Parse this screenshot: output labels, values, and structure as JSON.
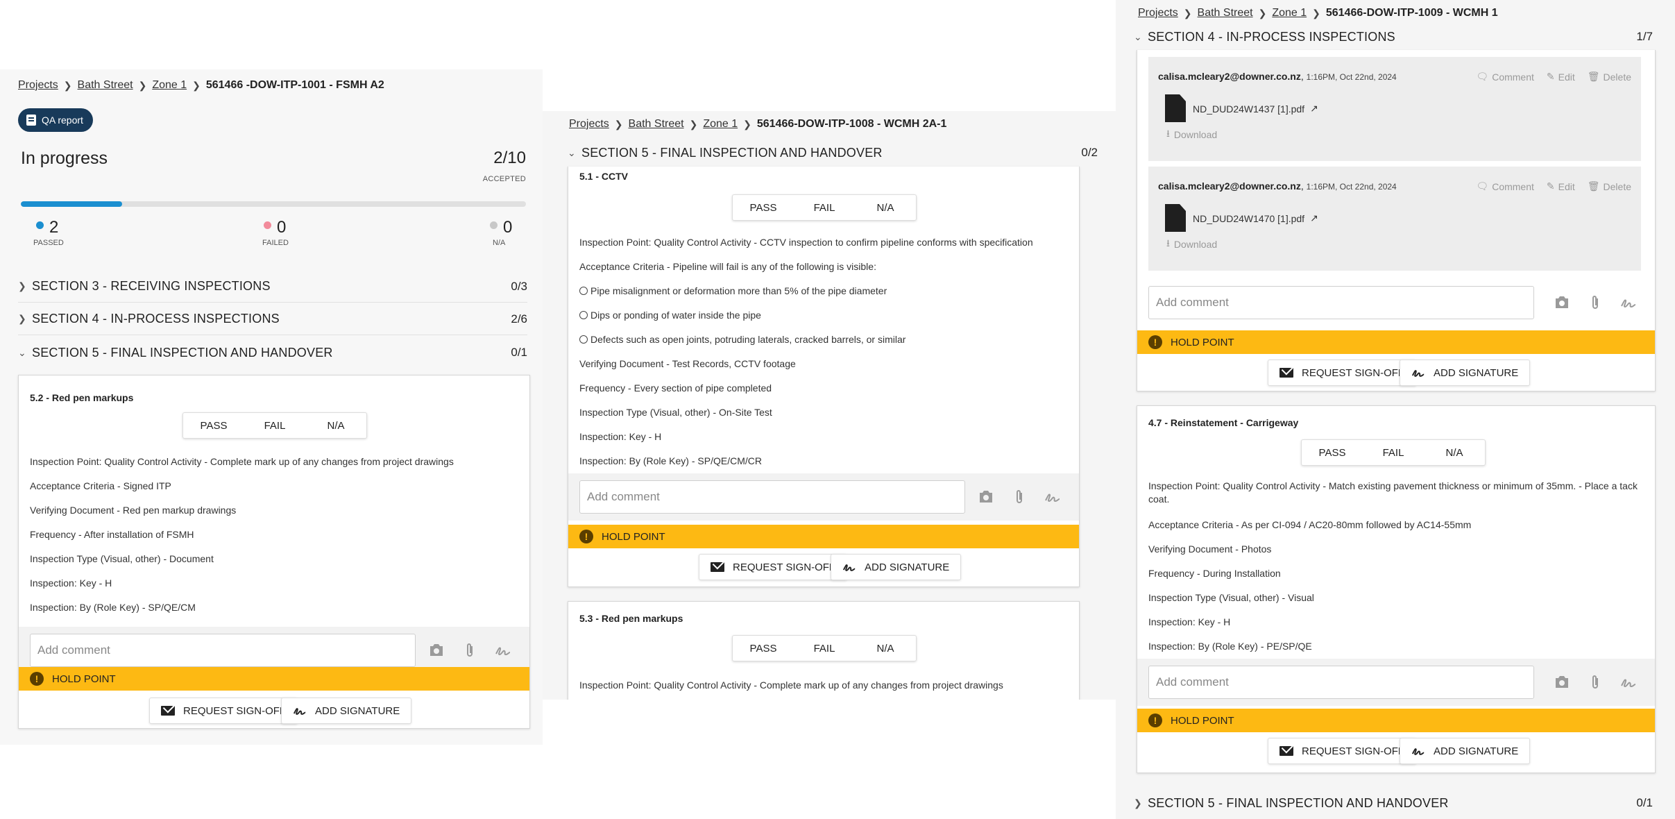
{
  "panel1": {
    "breadcrumb": {
      "projects": "Projects",
      "site": "Bath Street",
      "zone": "Zone 1",
      "current": "561466 -DOW-ITP-1001 - FSMH A2"
    },
    "qa_report": "QA report",
    "status": "In progress",
    "count": "2/10",
    "count_label": "ACCEPTED",
    "progress": 0.2,
    "stats": {
      "passed": {
        "num": "2",
        "label": "PASSED",
        "color": "#1b8fd0"
      },
      "failed": {
        "num": "0",
        "label": "FAILED",
        "color": "#f28b9b"
      },
      "na": {
        "num": "0",
        "label": "N/A",
        "color": "#c8c8c8"
      }
    },
    "sections": [
      {
        "title": "SECTION 3 - RECEIVING INSPECTIONS",
        "count": "0/3"
      },
      {
        "title": "SECTION 4 - IN-PROCESS INSPECTIONS",
        "count": "2/6"
      },
      {
        "title": "SECTION 5 - FINAL INSPECTION AND HANDOVER",
        "count": "0/1"
      }
    ],
    "card": {
      "title": "5.2 - Red pen markups",
      "pass": "PASS",
      "fail": "FAIL",
      "na": "N/A",
      "lines": [
        "Inspection Point: Quality Control Activity - Complete mark up of any changes from project drawings",
        "Acceptance Criteria - Signed ITP",
        "Verifying Document - Red pen markup drawings",
        "Frequency - After installation of FSMH",
        "Inspection Type (Visual, other) - Document",
        "Inspection: Key - H",
        "Inspection: By (Role Key) - SP/QE/CM"
      ],
      "comment_placeholder": "Add comment",
      "hold": "HOLD POINT",
      "request": "REQUEST SIGN-OFF",
      "signature": "ADD SIGNATURE"
    }
  },
  "panel2": {
    "breadcrumb": {
      "projects": "Projects",
      "site": "Bath Street",
      "zone": "Zone 1",
      "current": "561466-DOW-ITP-1008 - WCMH 2A-1"
    },
    "section": {
      "title": "SECTION 5 - FINAL INSPECTION AND HANDOVER",
      "count": "0/2"
    },
    "card1": {
      "title": "5.1 - CCTV",
      "pass": "PASS",
      "fail": "FAIL",
      "na": "N/A",
      "lines": [
        "Inspection Point: Quality Control Activity - CCTV inspection to confirm pipeline conforms with specification",
        "Acceptance Criteria - Pipeline will fail is any of the following is visible:",
        "Pipe misalignment or deformation more than 5% of the pipe diameter",
        "Dips or ponding of water inside the pipe",
        "Defects such as open joints, potruding laterals, cracked barrels, or similar",
        "Verifying Document - Test Records, CCTV footage",
        "Frequency - Every section of pipe completed",
        "Inspection Type (Visual, other) - On-Site Test",
        "Inspection: Key - H",
        "Inspection: By (Role Key) - SP/QE/CM/CR"
      ],
      "comment_placeholder": "Add comment",
      "hold": "HOLD POINT",
      "request": "REQUEST SIGN-OFF",
      "signature": "ADD SIGNATURE"
    },
    "card2": {
      "title": "5.3 - Red pen markups",
      "pass": "PASS",
      "fail": "FAIL",
      "na": "N/A",
      "line1": "Inspection Point: Quality Control Activity - Complete mark up of any changes from project drawings"
    }
  },
  "panel3": {
    "breadcrumb": {
      "projects": "Projects",
      "site": "Bath Street",
      "zone": "Zone 1",
      "current": "561466-DOW-ITP-1009 - WCMH 1"
    },
    "section4": {
      "title": "SECTION 4 - IN-PROCESS INSPECTIONS",
      "count": "1/7"
    },
    "attachments": [
      {
        "user": "calisa.mcleary2@downer.co.nz",
        "time": "1:16PM, Oct 22nd, 2024",
        "file": "ND_DUD24W1437 [1].pdf",
        "comment": "Comment",
        "edit": "Edit",
        "delete": "Delete",
        "download": "Download"
      },
      {
        "user": "calisa.mcleary2@downer.co.nz",
        "time": "1:16PM, Oct 22nd, 2024",
        "file": "ND_DUD24W1470 [1].pdf",
        "comment": "Comment",
        "edit": "Edit",
        "delete": "Delete",
        "download": "Download"
      }
    ],
    "top_card": {
      "comment_placeholder": "Add comment",
      "hold": "HOLD POINT",
      "request": "REQUEST SIGN-OFF",
      "signature": "ADD SIGNATURE"
    },
    "card": {
      "title": "4.7 - Reinstatement - Carrigeway",
      "pass": "PASS",
      "fail": "FAIL",
      "na": "N/A",
      "lines": [
        "Inspection Point: Quality Control Activity - Match existing pavement thickness or minimum of 35mm. - Place a tack coat.",
        "Acceptance Criteria - As per CI-094 / AC20-80mm followed by AC14-55mm",
        "Verifying Document - Photos",
        "Frequency - During Installation",
        "Inspection Type (Visual, other) - Visual",
        "Inspection: Key - H",
        "Inspection: By (Role Key) - PE/SP/QE"
      ],
      "comment_placeholder": "Add comment",
      "hold": "HOLD POINT",
      "request": "REQUEST SIGN-OFF",
      "signature": "ADD SIGNATURE"
    },
    "section5": {
      "title": "SECTION 5 - FINAL INSPECTION AND HANDOVER",
      "count": "0/1"
    }
  },
  "colors": {
    "brand": "#183a5a",
    "accent": "#1b8fd0",
    "hold": "#fdb913"
  },
  "icons": [
    "camera-icon",
    "paperclip-icon",
    "signature-icon",
    "envelope-icon",
    "warning-icon",
    "chevron-right-icon",
    "chevron-down-icon",
    "file-icon",
    "download-icon",
    "external-link-icon",
    "comment-icon",
    "edit-icon",
    "delete-icon",
    "report-icon"
  ]
}
